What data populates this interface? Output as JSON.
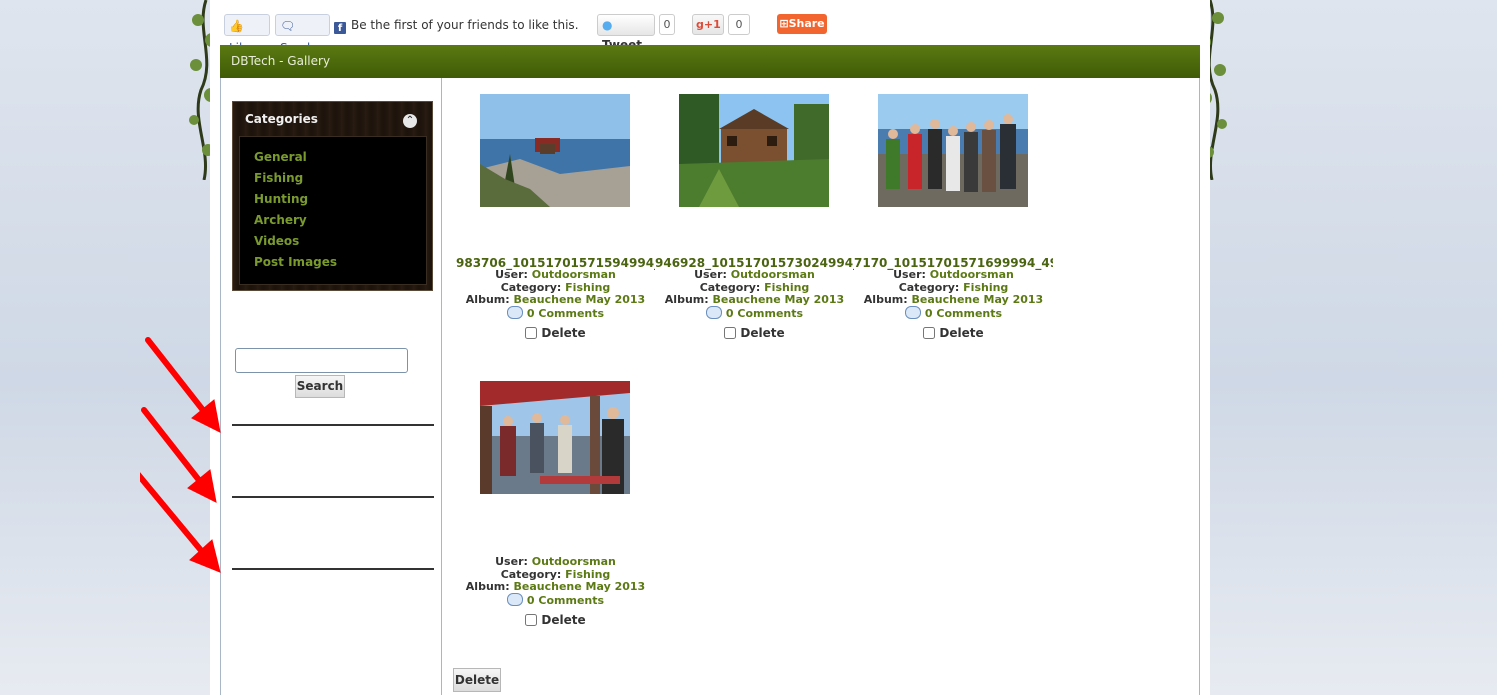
{
  "social": {
    "like_label": "Like",
    "send_label": "Send",
    "fb_text": "Be the first of your friends to like this.",
    "tweet_label": "Tweet",
    "tweet_count": "0",
    "gplus_label": "+1",
    "gplus_count": "0",
    "share_label": "Share"
  },
  "header": {
    "title": "DBTech - Gallery"
  },
  "sidebar": {
    "categories_title": "Categories",
    "categories": [
      "General",
      "Fishing",
      "Hunting",
      "Archery",
      "Videos",
      "Post Images"
    ],
    "search_label": "Search",
    "search_value": ""
  },
  "gallery": {
    "items": [
      {
        "title": "983706_10151701571594994_...",
        "user_label": "User:",
        "user": "Outdoorsman",
        "category_label": "Category:",
        "category": "Fishing",
        "album_label": "Album:",
        "album": "Beauchene May 2013",
        "comments": "0 Comments",
        "delete_label": "Delete"
      },
      {
        "title": "946928_10151701573024994_...",
        "user_label": "User:",
        "user": "Outdoorsman",
        "category_label": "Category:",
        "category": "Fishing",
        "album_label": "Album:",
        "album": "Beauchene May 2013",
        "comments": "0 Comments",
        "delete_label": "Delete"
      },
      {
        "title": "7170_10151701571699994_49...",
        "user_label": "User:",
        "user": "Outdoorsman",
        "category_label": "Category:",
        "category": "Fishing",
        "album_label": "Album:",
        "album": "Beauchene May 2013",
        "comments": "0 Comments",
        "delete_label": "Delete"
      },
      {
        "title": "",
        "user_label": "User:",
        "user": "Outdoorsman",
        "category_label": "Category:",
        "category": "Fishing",
        "album_label": "Album:",
        "album": "Beauchene May 2013",
        "comments": "0 Comments",
        "delete_label": "Delete"
      }
    ],
    "delete_button": "Delete"
  },
  "colors": {
    "header_green": "#4a6a0c",
    "link_green": "#5c7a14",
    "annotation_red": "#ff0000"
  }
}
